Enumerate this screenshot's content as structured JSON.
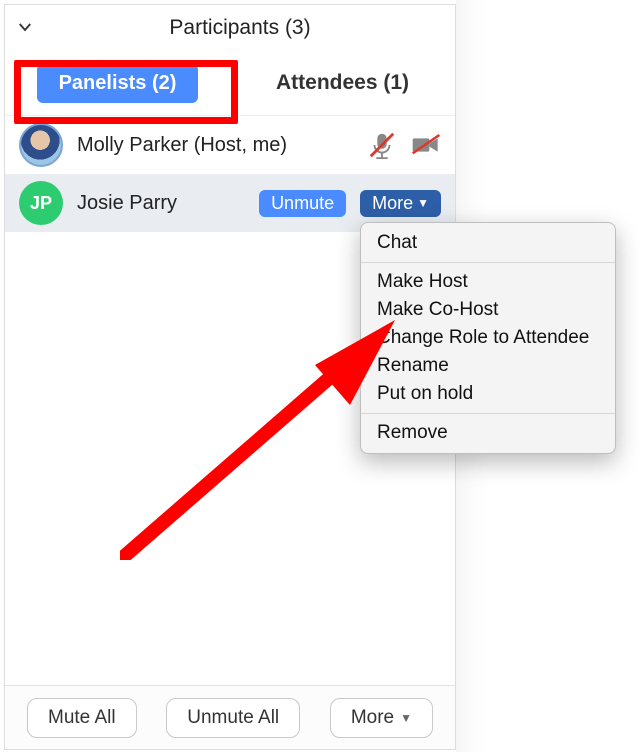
{
  "header": {
    "title": "Participants (3)"
  },
  "tabs": {
    "panelists": "Panelists (2)",
    "attendees": "Attendees (1)"
  },
  "participants": [
    {
      "name": "Molly Parker (Host, me)",
      "initials": ""
    },
    {
      "name": "Josie Parry",
      "initials": "JP"
    }
  ],
  "row_buttons": {
    "unmute": "Unmute",
    "more": "More"
  },
  "dropdown": {
    "chat": "Chat",
    "make_host": "Make Host",
    "make_cohost": "Make Co-Host",
    "change_role": "Change Role to Attendee",
    "rename": "Rename",
    "hold": "Put on hold",
    "remove": "Remove"
  },
  "footer": {
    "mute_all": "Mute All",
    "unmute_all": "Unmute All",
    "more": "More"
  }
}
